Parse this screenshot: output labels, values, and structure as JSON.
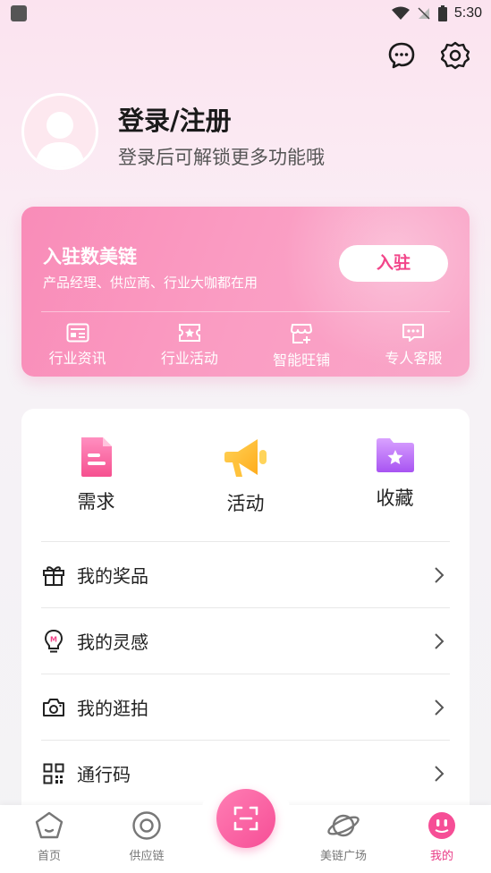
{
  "status_bar": {
    "time": "5:30"
  },
  "profile": {
    "title": "登录/注册",
    "subtitle": "登录后可解锁更多功能哦"
  },
  "join_card": {
    "title": "入驻数美链",
    "subtitle": "产品经理、供应商、行业大咖都在用",
    "button_label": "入驻",
    "items": [
      {
        "label": "行业资讯",
        "icon": "news-icon"
      },
      {
        "label": "行业活动",
        "icon": "ticket-icon"
      },
      {
        "label": "智能旺铺",
        "icon": "shop-icon"
      },
      {
        "label": "专人客服",
        "icon": "chat-icon"
      }
    ]
  },
  "quick_actions": [
    {
      "label": "需求",
      "icon": "document-icon"
    },
    {
      "label": "活动",
      "icon": "megaphone-icon"
    },
    {
      "label": "收藏",
      "icon": "folder-star-icon"
    }
  ],
  "menu": [
    {
      "label": "我的奖品",
      "icon": "gift-icon"
    },
    {
      "label": "我的灵感",
      "icon": "lightbulb-icon"
    },
    {
      "label": "我的逛拍",
      "icon": "camera-icon"
    },
    {
      "label": "通行码",
      "icon": "qrcode-icon"
    }
  ],
  "bottom_nav": [
    {
      "label": "首页",
      "icon": "home-icon"
    },
    {
      "label": "供应链",
      "icon": "target-icon"
    },
    {
      "label": "美链广场",
      "icon": "planet-icon"
    },
    {
      "label": "我的",
      "icon": "profile-face-icon"
    }
  ],
  "colors": {
    "accent": "#f2468a",
    "card_pink": "#f98cb8",
    "active_nav": "#e93a86"
  }
}
